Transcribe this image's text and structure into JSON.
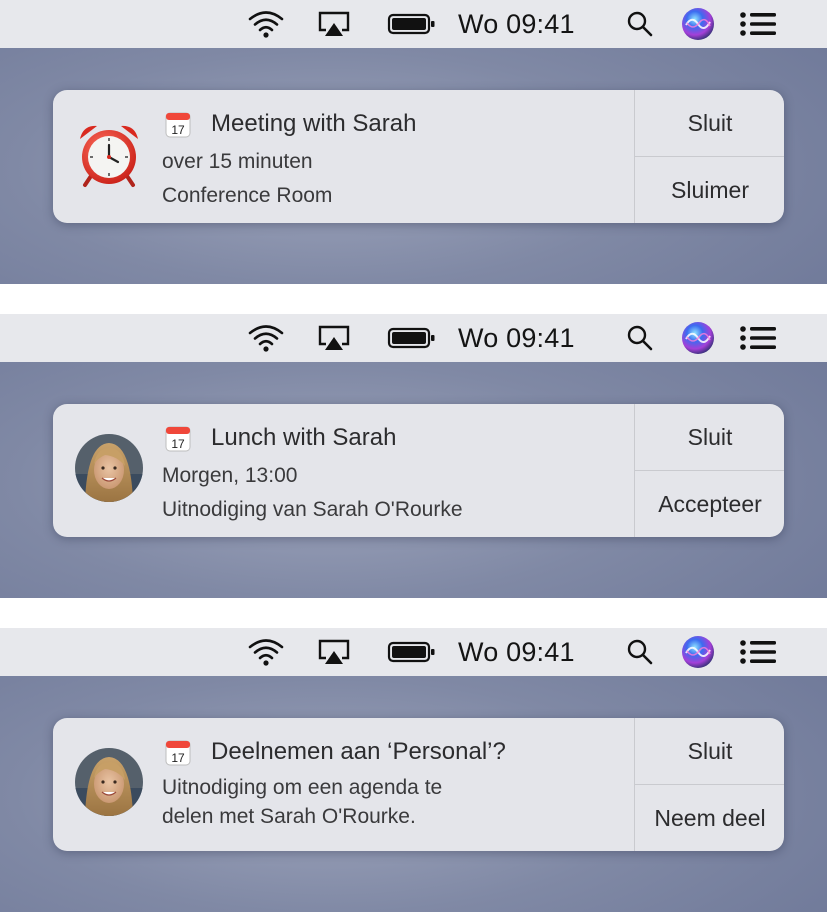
{
  "menubar": {
    "clock": "Wo 09:41",
    "icons": [
      "wifi-icon",
      "airplay-icon",
      "battery-icon",
      "spotlight-search-icon",
      "siri-icon",
      "notification-center-icon"
    ]
  },
  "notifications": [
    {
      "app_icon": "calendar-icon",
      "image": "alarm-clock",
      "title": "Meeting with Sarah",
      "lines": [
        "over 15 minuten",
        "Conference Room"
      ],
      "actions": [
        "Sluit",
        "Sluimer"
      ]
    },
    {
      "app_icon": "calendar-icon",
      "image": "avatar",
      "title": "Lunch with Sarah",
      "lines": [
        "Morgen, 13:00",
        "Uitnodiging van Sarah O'Rourke"
      ],
      "actions": [
        "Sluit",
        "Accepteer"
      ]
    },
    {
      "app_icon": "calendar-icon",
      "image": "avatar",
      "title": "Deelnemen aan ‘Personal’?",
      "lines": [
        "Uitnodiging om een agenda te",
        "delen met Sarah O'Rourke."
      ],
      "actions": [
        "Sluit",
        "Neem deel"
      ]
    }
  ],
  "colors": {
    "menubar": "#e7e8ec",
    "desktop": "#7b84a1",
    "notification_bg": "#e4e5ea",
    "siri_gradient": [
      "#3d5bff",
      "#b03bd6",
      "#2ec9e8"
    ]
  },
  "calendar_icon_day": "17"
}
